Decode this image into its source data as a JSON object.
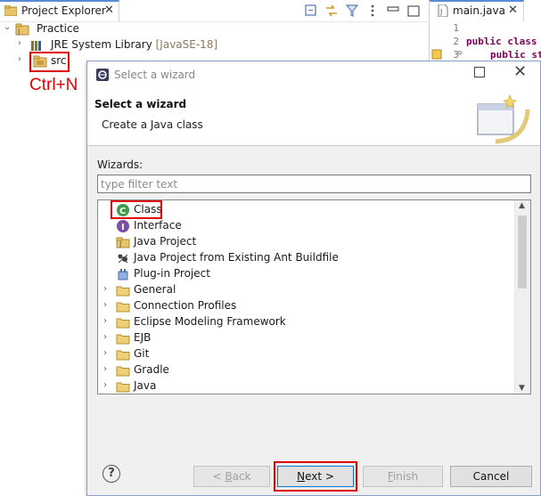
{
  "explorer": {
    "tab_label": "Project Explorer",
    "tree": [
      {
        "label": "Practice",
        "icon": "project-folder-icon",
        "expanded": true
      },
      {
        "label": "JRE System Library",
        "decoration": "[JavaSE-18]",
        "icon": "library-icon",
        "expanded": false
      },
      {
        "label": "src",
        "icon": "package-folder-icon",
        "expanded": false
      }
    ],
    "annotation": "Ctrl+N",
    "highlight_color": "#e00000"
  },
  "editor": {
    "tab_label": "main.java",
    "lines": [
      {
        "num": "1",
        "code": ""
      },
      {
        "num": "2",
        "code": "public class"
      },
      {
        "num": "3",
        "code": "public st"
      }
    ]
  },
  "dialog": {
    "title": "Select a wizard",
    "banner_title": "Select a wizard",
    "banner_description": "Create a Java class",
    "wizards_label": "Wizards:",
    "filter_placeholder": "type filter text",
    "items": [
      {
        "label": "Class",
        "icon": "java-class-icon",
        "selected": true
      },
      {
        "label": "Interface",
        "icon": "java-interface-icon"
      },
      {
        "label": "Java Project",
        "icon": "java-project-icon"
      },
      {
        "label": "Java Project from Existing Ant Buildfile",
        "icon": "ant-icon"
      },
      {
        "label": "Plug-in Project",
        "icon": "plugin-icon"
      },
      {
        "label": "General",
        "icon": "folder-icon",
        "category": true
      },
      {
        "label": "Connection Profiles",
        "icon": "folder-icon",
        "category": true
      },
      {
        "label": "Eclipse Modeling Framework",
        "icon": "folder-icon",
        "category": true
      },
      {
        "label": "EJB",
        "icon": "folder-icon",
        "category": true
      },
      {
        "label": "Git",
        "icon": "folder-icon",
        "category": true
      },
      {
        "label": "Gradle",
        "icon": "folder-icon",
        "category": true
      },
      {
        "label": "Java",
        "icon": "folder-icon",
        "category": true
      }
    ],
    "buttons": {
      "help": "?",
      "back_prefix": "< ",
      "back_key": "B",
      "back_rest": "ack",
      "next_key": "N",
      "next_rest": "ext >",
      "finish_key": "F",
      "finish_rest": "inish",
      "cancel": "Cancel"
    }
  }
}
